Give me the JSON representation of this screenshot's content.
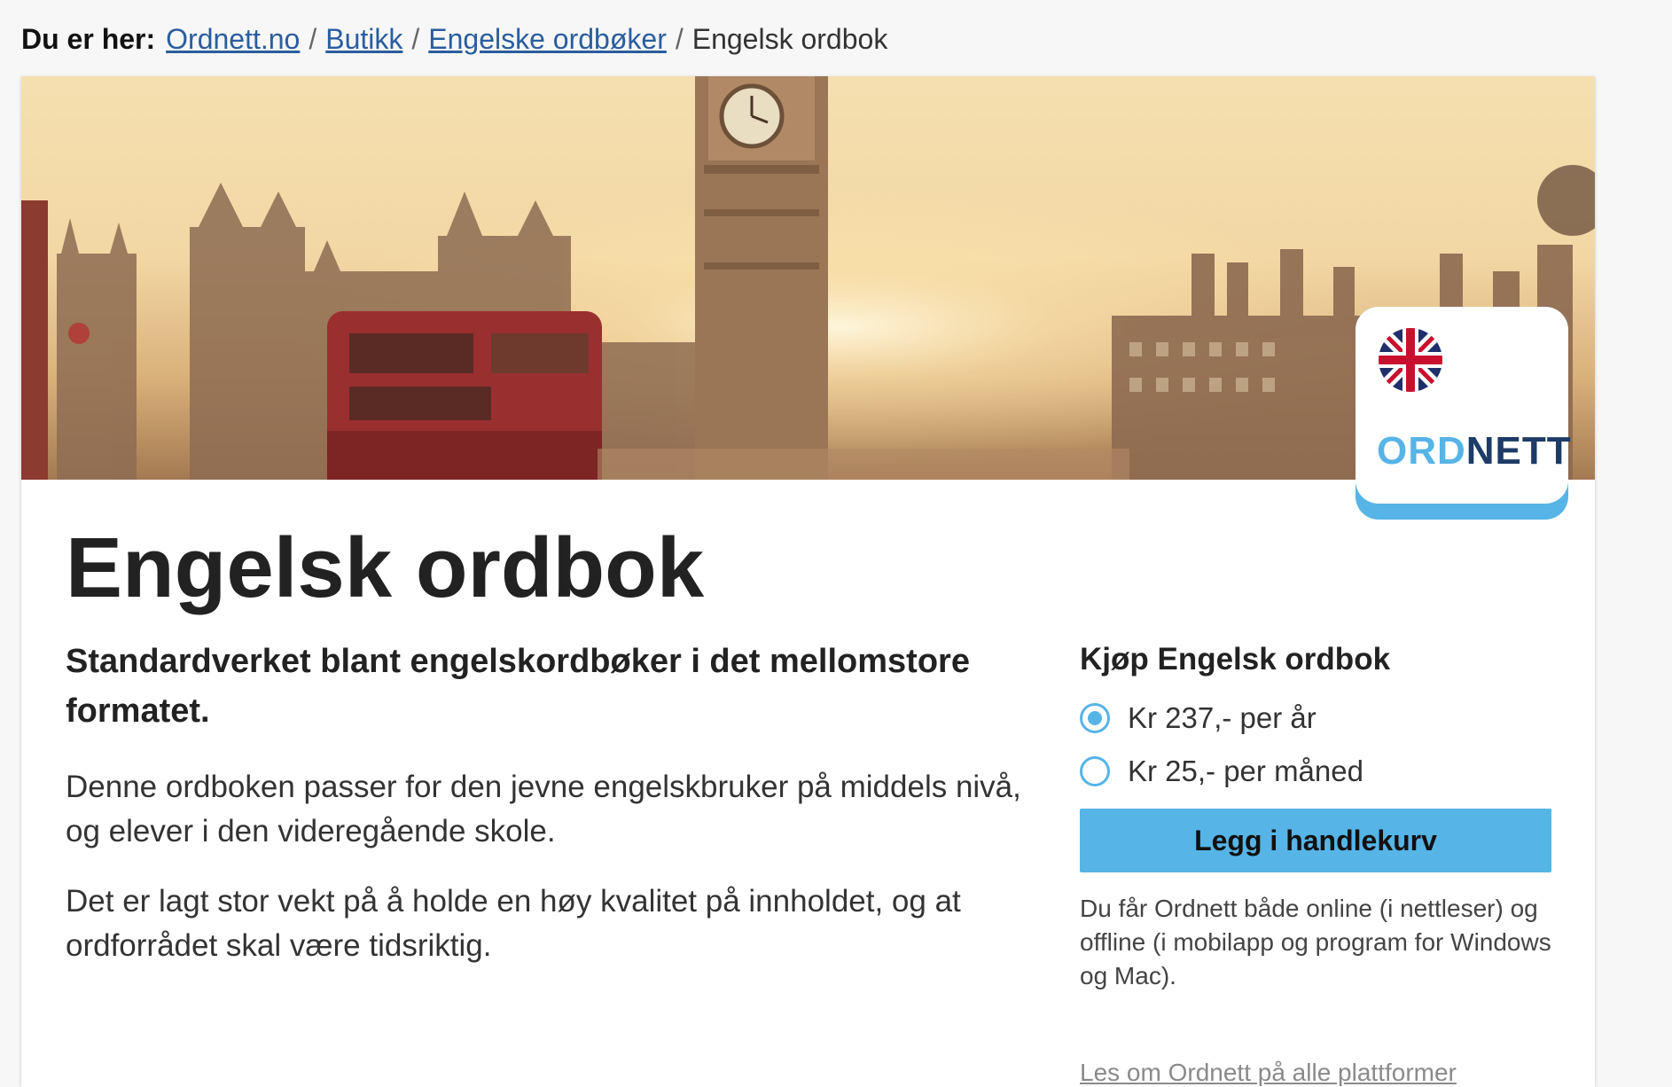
{
  "breadcrumb": {
    "lead": "Du er her:",
    "items": [
      "Ordnett.no",
      "Butikk",
      "Engelske ordbøker"
    ],
    "current": "Engelsk ordbok",
    "separator": "/"
  },
  "badge": {
    "logo_part1": "ORD",
    "logo_part2": "NETT",
    "flag_icon": "uk-flag-icon",
    "accent": "#56b4e6",
    "logo_dark": "#1d3b66"
  },
  "product": {
    "title": "Engelsk ordbok",
    "lead": "Standardverket blant engelskordbøker i det mellomstore formatet.",
    "paragraphs": [
      "Denne ordboken passer for den jevne engelskbruker på middels nivå, og elever i den videregående skole.",
      "Det er lagt stor vekt på å holde en høy kvalitet på innholdet, og at ordforrådet skal være tidsriktig."
    ]
  },
  "purchase": {
    "title": "Kjøp Engelsk ordbok",
    "options": [
      {
        "label": "Kr 237,- per år",
        "selected": true
      },
      {
        "label": "Kr 25,- per måned",
        "selected": false
      }
    ],
    "button_label": "Legg i handlekurv",
    "info": "Du får Ordnett både online (i nettleser) og offline (i mobilapp og program for Windows og Mac).",
    "info_link": "Les om Ordnett på alle plattformer"
  }
}
